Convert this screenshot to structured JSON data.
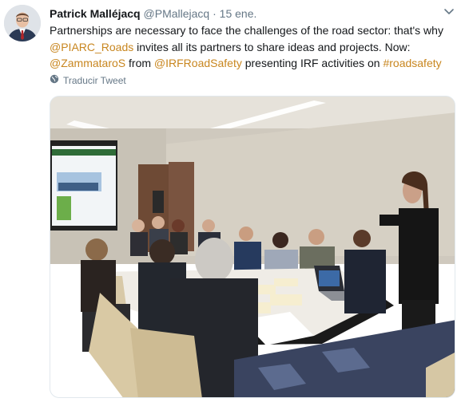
{
  "tweet": {
    "author_name": "Patrick Malléjacq",
    "author_handle": "@PMallejacq",
    "separator": "·",
    "timestamp": "15 ene.",
    "text_part1": "Partnerships are necessary to face the challenges of the road sector: that's why ",
    "mention_piarc": "@PIARC_Roads",
    "text_part2": " invites all its partners to share ideas and projects. Now: ",
    "mention_zammataro": "@ZammataroS",
    "text_part3": " from ",
    "mention_irf": "@IRFRoadSafety",
    "text_part4": " presenting IRF activities on ",
    "hashtag": "#roadsafety",
    "translate_label": "Traducir Tweet"
  },
  "icons": {
    "caret": "chevron-down-icon",
    "translate": "globe-icon"
  },
  "colors": {
    "link": "#c8861f",
    "secondary_text": "#657786",
    "primary_text": "#14171a"
  }
}
